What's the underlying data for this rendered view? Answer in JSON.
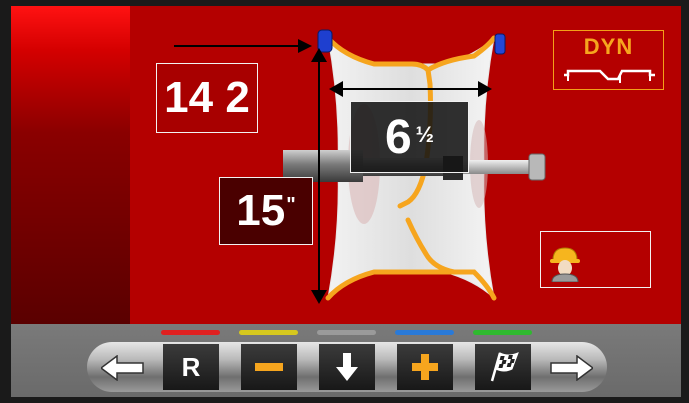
{
  "display": {
    "offset_value": "14 2",
    "width_whole": "6",
    "width_fraction": "½",
    "diameter_value": "15",
    "diameter_unit": "\"",
    "mode_label": "DYN"
  },
  "toolbar": {
    "indicator_colors": [
      "#e02020",
      "#d6c81e",
      "#9a9a9a",
      "#2a7ad8",
      "#2fb92f"
    ],
    "buttons": [
      {
        "name": "back-button",
        "icon": "arrow-left-icon"
      },
      {
        "name": "r-button",
        "label": "R"
      },
      {
        "name": "minus-button",
        "icon": "minus-icon"
      },
      {
        "name": "down-button",
        "icon": "arrow-down-icon"
      },
      {
        "name": "plus-button",
        "icon": "plus-icon"
      },
      {
        "name": "finish-button",
        "icon": "checkered-flag-icon"
      },
      {
        "name": "forward-button",
        "icon": "arrow-right-icon"
      }
    ]
  },
  "colors": {
    "background": "#b40000",
    "accent": "#f6a51e",
    "toolbar": "#707070"
  }
}
